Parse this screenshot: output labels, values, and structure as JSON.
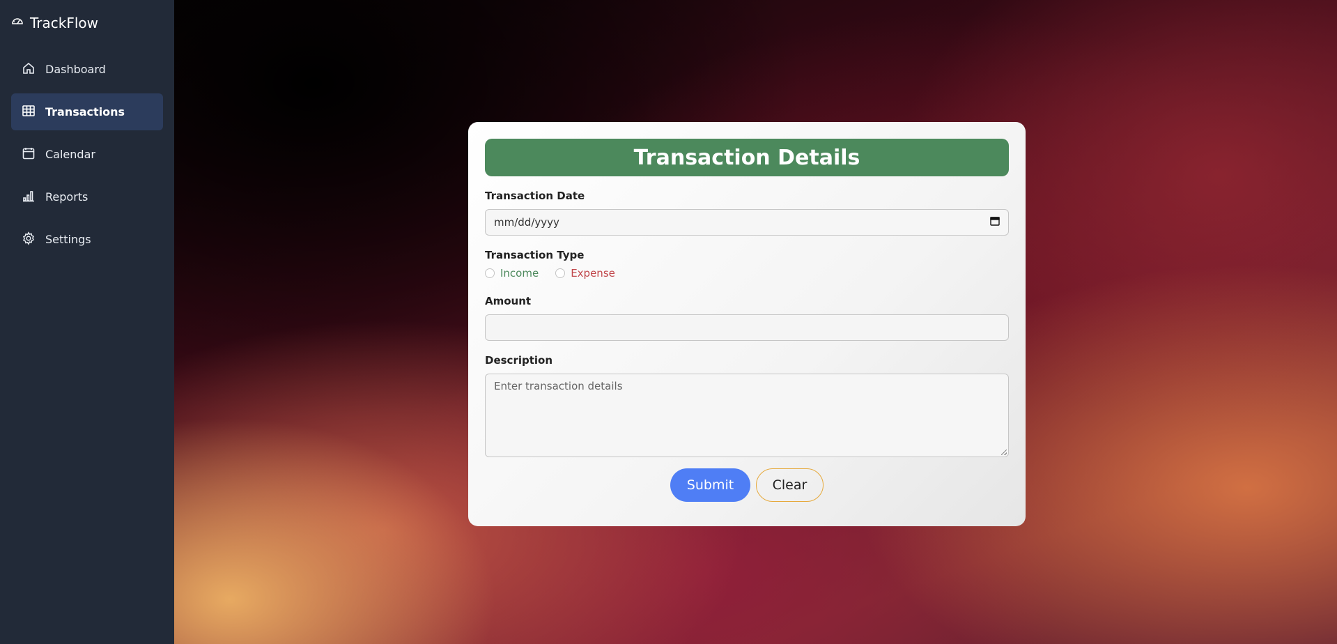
{
  "app": {
    "name": "TrackFlow",
    "brand_icon": "gauge-icon"
  },
  "sidebar": {
    "items": [
      {
        "label": "Dashboard",
        "icon": "home-icon",
        "active": false
      },
      {
        "label": "Transactions",
        "icon": "table-icon",
        "active": true
      },
      {
        "label": "Calendar",
        "icon": "calendar-icon",
        "active": false
      },
      {
        "label": "Reports",
        "icon": "bar-chart-icon",
        "active": false
      },
      {
        "label": "Settings",
        "icon": "gear-icon",
        "active": false
      }
    ]
  },
  "form": {
    "title": "Transaction Details",
    "date_label": "Transaction Date",
    "date_placeholder": "mm/dd/yyyy",
    "type_label": "Transaction Type",
    "type_options": {
      "income": "Income",
      "expense": "Expense"
    },
    "amount_label": "Amount",
    "amount_value": "",
    "description_label": "Description",
    "description_placeholder": "Enter transaction details",
    "submit_label": "Submit",
    "clear_label": "Clear"
  },
  "colors": {
    "sidebar_bg": "#222a38",
    "active_item_bg": "#2c3c5c",
    "title_bar": "#4c895c",
    "income": "#4c895c",
    "expense": "#c0464a",
    "submit_bg": "#4f7ef5",
    "clear_border": "#e6a93b"
  }
}
